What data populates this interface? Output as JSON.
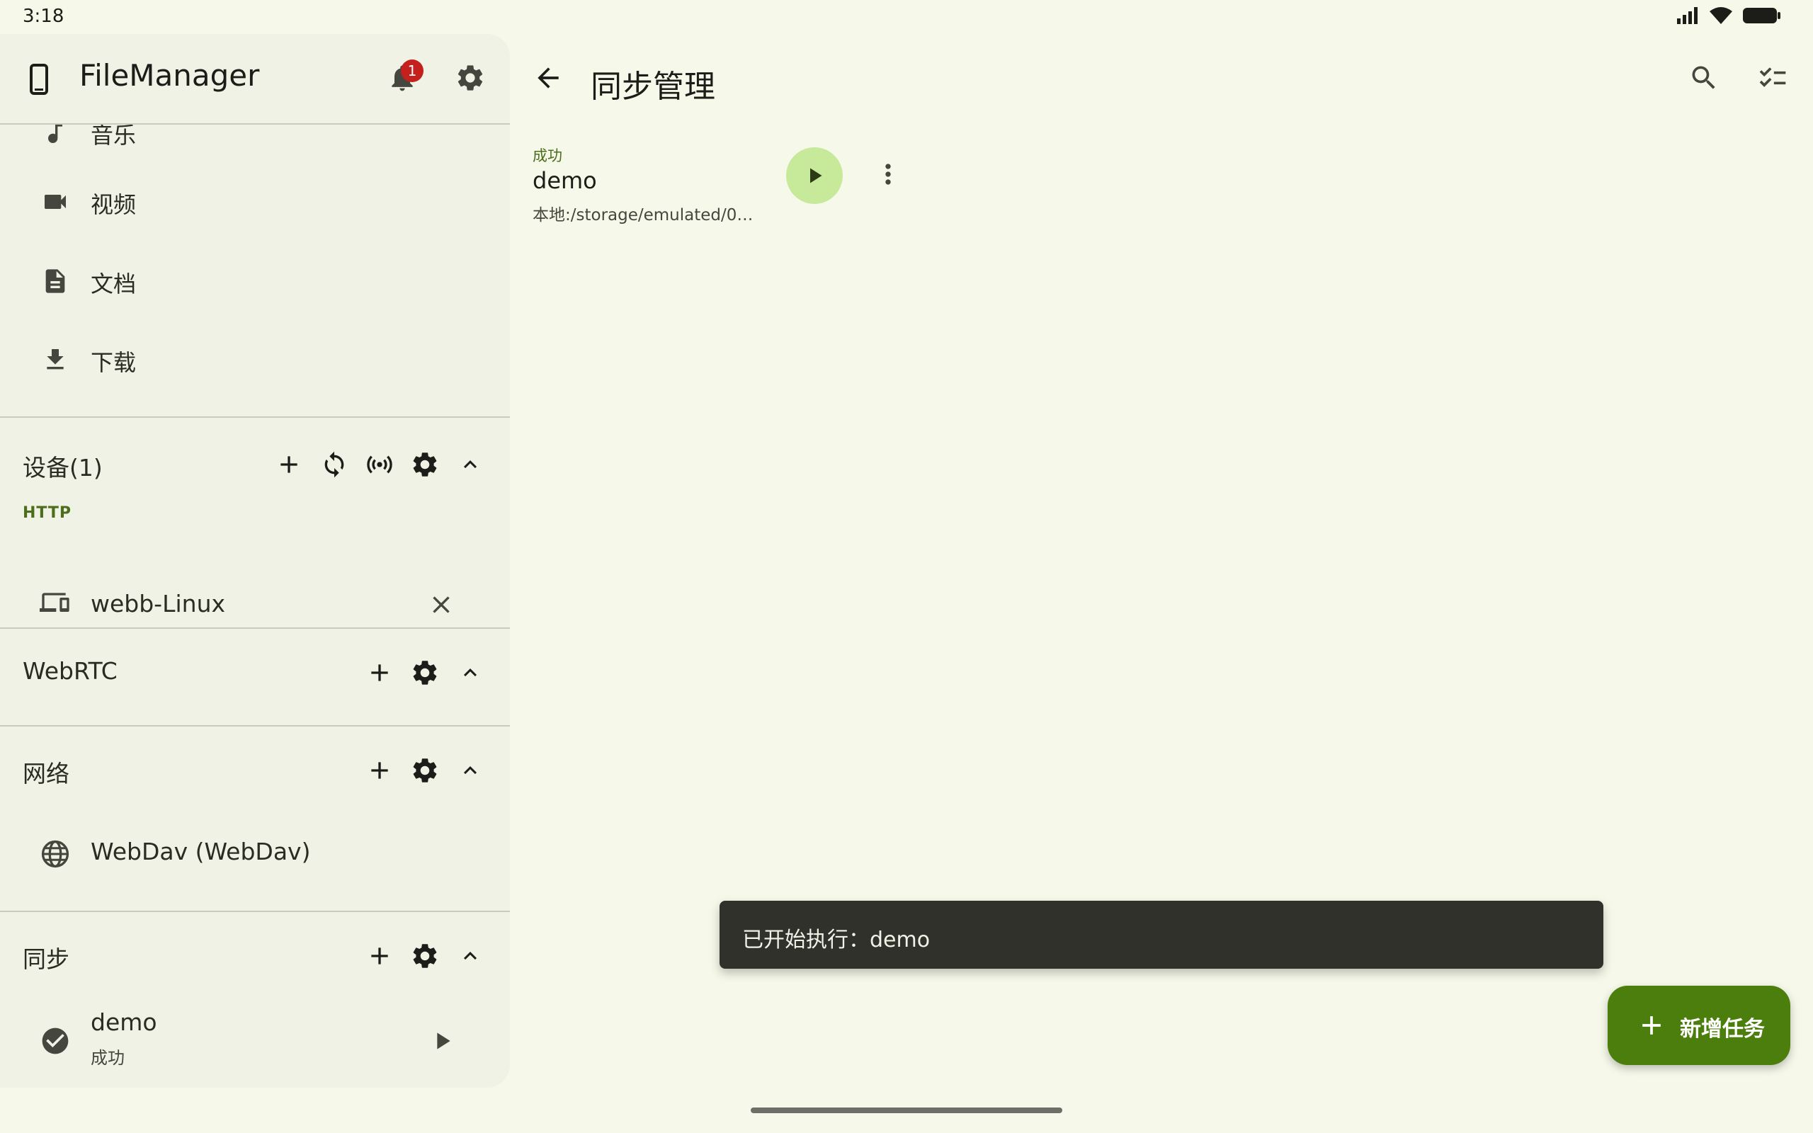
{
  "status_bar": {
    "time": "3:18"
  },
  "sidebar": {
    "app_title": "FileManager",
    "notification_count": "1",
    "nav_items": [
      {
        "label": "音乐",
        "icon": "music-icon"
      },
      {
        "label": "视频",
        "icon": "video-icon"
      },
      {
        "label": "文档",
        "icon": "document-icon"
      },
      {
        "label": "下载",
        "icon": "download-icon"
      }
    ],
    "devices": {
      "title": "设备(1)",
      "subheader": "HTTP",
      "items": [
        {
          "label": "webb-Linux",
          "icon": "devices-icon"
        }
      ]
    },
    "webrtc": {
      "title": "WebRTC"
    },
    "network": {
      "title": "网络",
      "items": [
        {
          "label": "WebDav (WebDav)",
          "icon": "globe-icon"
        }
      ]
    },
    "sync": {
      "title": "同步",
      "items": [
        {
          "label": "demo",
          "status": "成功",
          "icon": "check-circle-icon"
        }
      ]
    }
  },
  "main": {
    "title": "同步管理",
    "tasks": [
      {
        "status": "成功",
        "name": "demo",
        "path": "本地:/storage/emulated/0…"
      }
    ],
    "snackbar": "已开始执行：demo",
    "fab_label": "新增任务"
  },
  "colors": {
    "background": "#f6f9ea",
    "sidebar": "#f0f2e5",
    "accent": "#4c7e0e",
    "success_text": "#4c6d1a",
    "play_button": "#c7ea9a",
    "badge": "#c3201e"
  }
}
